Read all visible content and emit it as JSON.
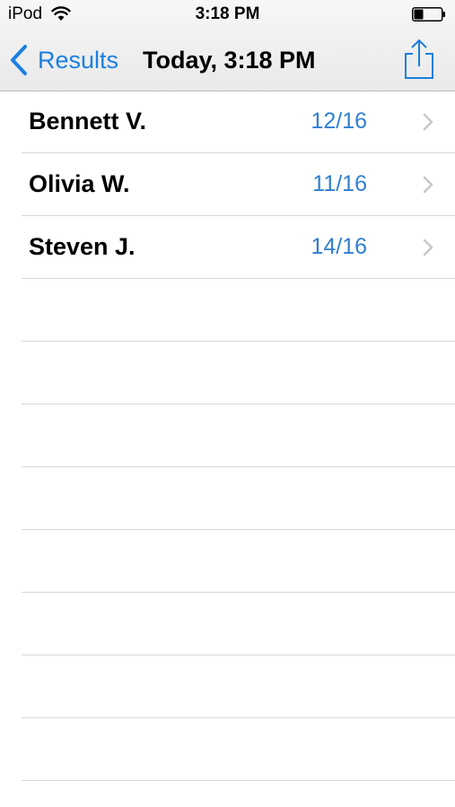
{
  "status_bar": {
    "carrier": "iPod",
    "time": "3:18 PM",
    "wifi_icon": "wifi-icon",
    "battery_icon": "battery-icon"
  },
  "nav": {
    "back_label": "Results",
    "title": "Today, 3:18 PM",
    "share_icon": "share-icon",
    "accent_color": "#1a7fe0"
  },
  "results": [
    {
      "name": "Bennett V.",
      "score": "12/16"
    },
    {
      "name": "Olivia W.",
      "score": "11/16"
    },
    {
      "name": "Steven J.",
      "score": "14/16"
    }
  ]
}
